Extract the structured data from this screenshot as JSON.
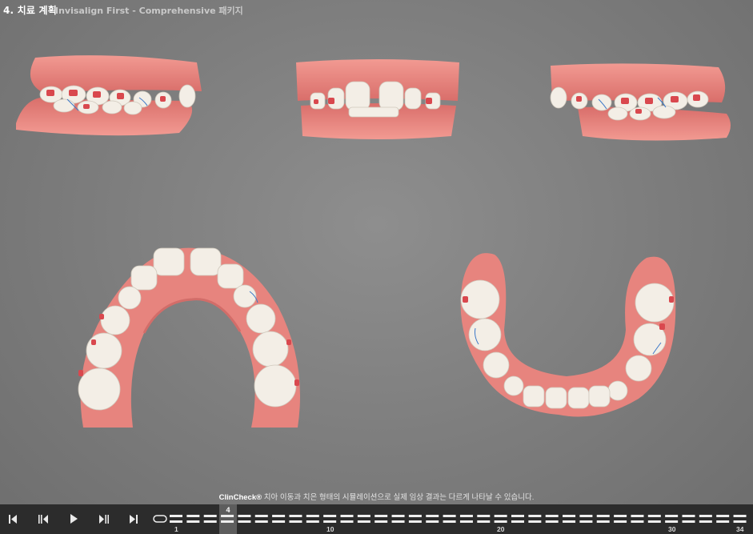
{
  "header": {
    "step_title": "4. 치료 계획",
    "package_name": "Invisalign First - Comprehensive 패키지"
  },
  "views": [
    {
      "name": "right-buccal-view"
    },
    {
      "name": "anterior-view"
    },
    {
      "name": "left-buccal-view"
    },
    {
      "name": "maxillary-occlusal-view"
    },
    {
      "name": "mandibular-occlusal-view"
    }
  ],
  "disclaimer": {
    "brand": "ClinCheck®",
    "text": " 치아 이동과 치은 형태의 시뮬레이션으로 실제 임상 결과는 다르게 나타날 수 있습니다."
  },
  "player": {
    "buttons": [
      {
        "name": "first-stage-button",
        "icon": "skip-to-start-icon"
      },
      {
        "name": "previous-stage-button",
        "icon": "step-back-icon"
      },
      {
        "name": "play-button",
        "icon": "play-icon"
      },
      {
        "name": "next-stage-button",
        "icon": "step-forward-icon"
      },
      {
        "name": "last-stage-button",
        "icon": "skip-to-end-icon"
      }
    ],
    "current_stage": "4",
    "total_stages": 34,
    "tick_labels": [
      "1",
      "10",
      "20",
      "30",
      "34"
    ]
  },
  "colors": {
    "background": "#7f7f7f",
    "gum": "#e7847e",
    "tooth": "#f3eee6",
    "attachment": "#d9484e",
    "player_bar": "#2c2c2c"
  }
}
